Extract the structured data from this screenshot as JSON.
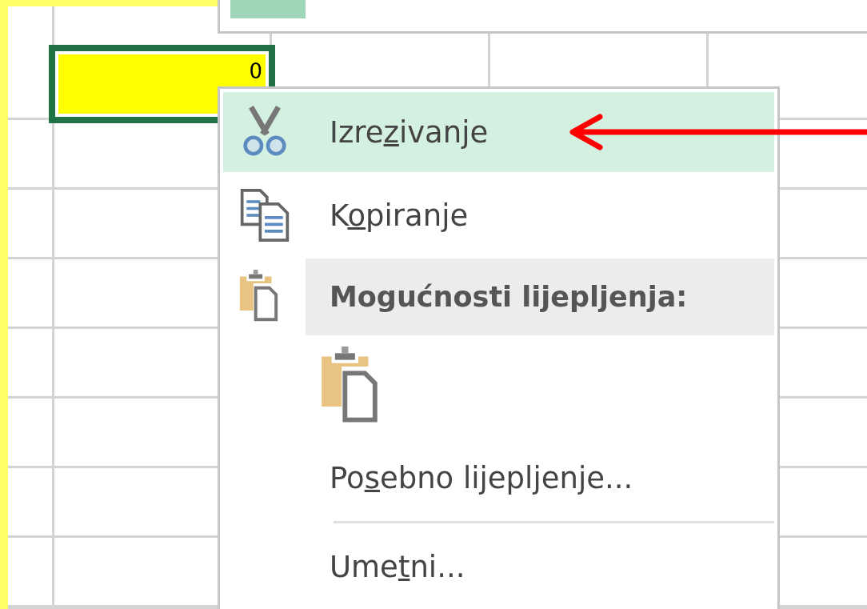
{
  "sheet": {
    "selected_cell": {
      "value": "0"
    }
  },
  "context_menu": {
    "items": [
      {
        "kind": "cut",
        "before": "Izre",
        "key": "z",
        "after": "ivanje",
        "selected": true
      },
      {
        "kind": "copy",
        "before": "K",
        "key": "o",
        "after": "piranje",
        "selected": false
      },
      {
        "kind": "paste_header",
        "label": "Mogućnosti lijepljenja:"
      },
      {
        "kind": "paste_option",
        "selected": false
      },
      {
        "kind": "command",
        "before": "Po",
        "key": "s",
        "after": "ebno lijepljenje...",
        "selected": false
      },
      {
        "kind": "divider"
      },
      {
        "kind": "command",
        "before": "Ume",
        "key": "t",
        "after": "ni...",
        "selected": false
      }
    ]
  }
}
